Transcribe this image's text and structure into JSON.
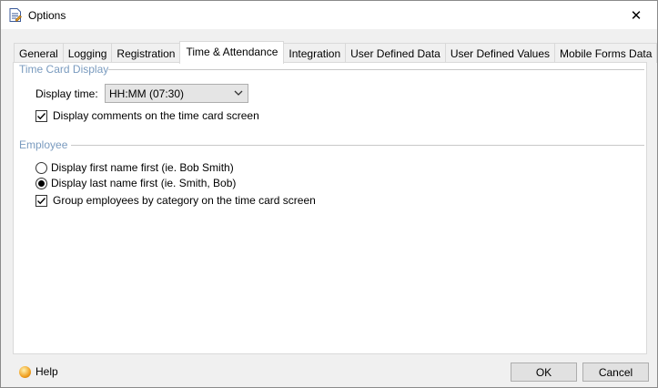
{
  "window": {
    "title": "Options",
    "close_glyph": "✕"
  },
  "tabs": [
    {
      "label": "General"
    },
    {
      "label": "Logging"
    },
    {
      "label": "Registration"
    },
    {
      "label": "Time & Attendance",
      "active": true
    },
    {
      "label": "Integration"
    },
    {
      "label": "User Defined Data"
    },
    {
      "label": "User Defined Values"
    },
    {
      "label": "Mobile Forms Data"
    }
  ],
  "time_card_display": {
    "group_label": "Time Card Display",
    "display_time_label": "Display time:",
    "display_time_value": "HH:MM (07:30)",
    "comments_checkbox_label": "Display comments on the time card screen",
    "comments_checked": true
  },
  "employee": {
    "group_label": "Employee",
    "radio_first_label": "Display first name first (ie. Bob Smith)",
    "radio_last_label": "Display last name first (ie. Smith, Bob)",
    "selected": "last",
    "group_checkbox_label": "Group employees by category on the time card screen",
    "group_checked": true
  },
  "footer": {
    "help_label": "Help",
    "ok_label": "OK",
    "cancel_label": "Cancel"
  },
  "colors": {
    "group_label": "#7a9bbf",
    "panel": "#ffffff",
    "window_bg": "#f0f0f0"
  }
}
